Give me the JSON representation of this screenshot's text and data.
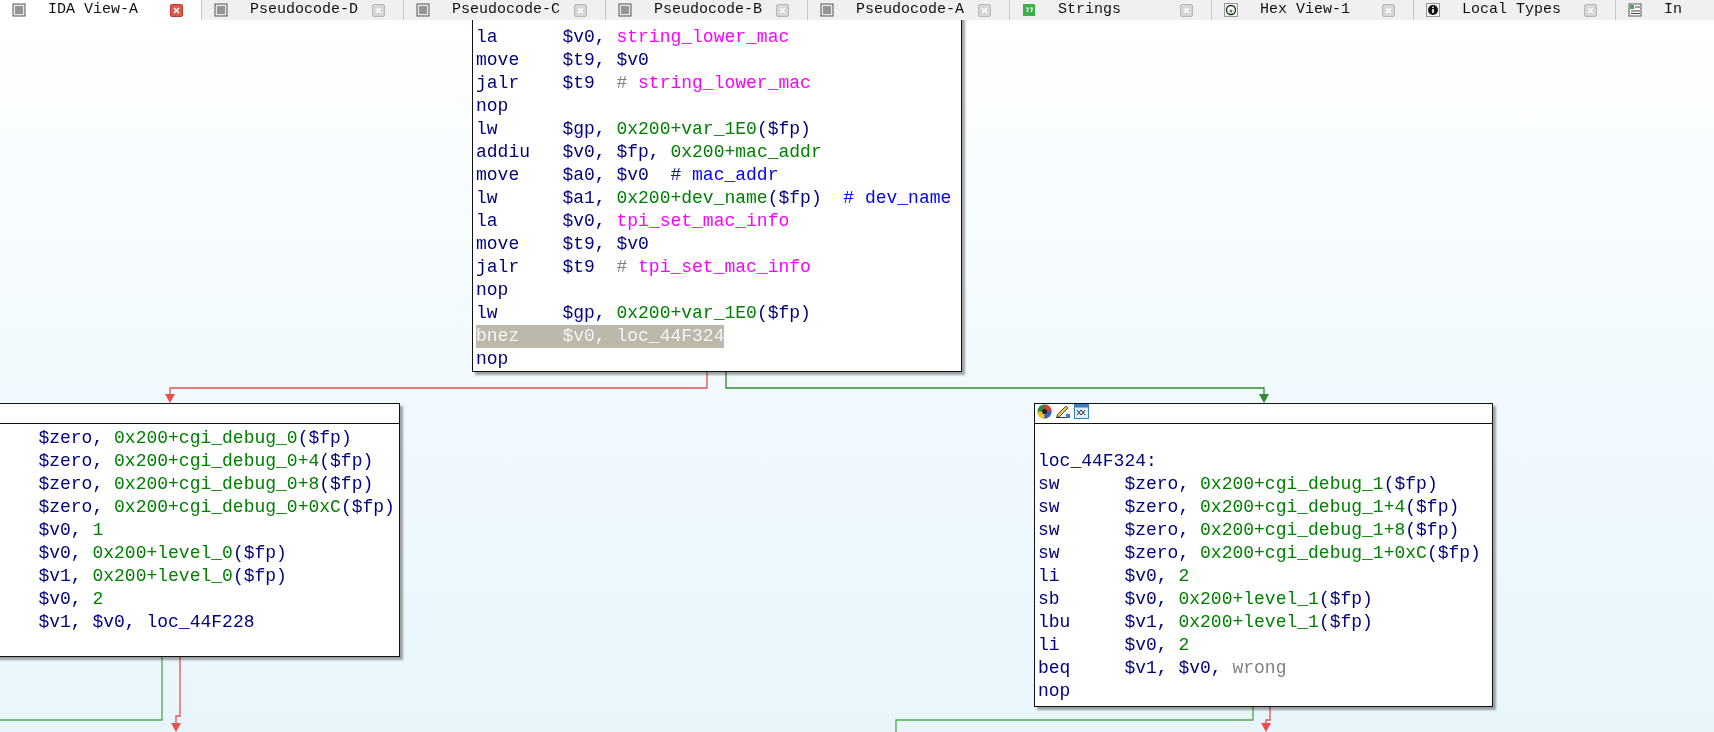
{
  "tabs": [
    {
      "label": "IDA View-A",
      "kind": "listing",
      "selected": true,
      "closable": true
    },
    {
      "label": "Pseudocode-D",
      "kind": "listing",
      "selected": false,
      "closable": true
    },
    {
      "label": "Pseudocode-C",
      "kind": "listing",
      "selected": false,
      "closable": true
    },
    {
      "label": "Pseudocode-B",
      "kind": "listing",
      "selected": false,
      "closable": true
    },
    {
      "label": "Pseudocode-A",
      "kind": "listing",
      "selected": false,
      "closable": true
    },
    {
      "label": "Strings",
      "kind": "strings",
      "selected": false,
      "closable": true
    },
    {
      "label": "Hex View-1",
      "kind": "hex",
      "selected": false,
      "closable": true
    },
    {
      "label": "Local Types",
      "kind": "types",
      "selected": false,
      "closable": true
    },
    {
      "label": "In",
      "kind": "structures",
      "selected": false
    }
  ],
  "graph": {
    "blocks": [
      {
        "kind": "top",
        "lines": [
          {
            "kind": "insn",
            "selected": false,
            "mnemonic": "la",
            "operands": [
              [
                {
                  "text": "$v0,",
                  "kind": "reg"
                }
              ],
              [
                {
                  "text": "string_lower_mac",
                  "kind": "name"
                }
              ]
            ]
          },
          {
            "kind": "insn",
            "selected": false,
            "mnemonic": "move",
            "operands": [
              [
                {
                  "text": "$t9,",
                  "kind": "reg"
                }
              ],
              [
                {
                  "text": "$v0",
                  "kind": "reg"
                }
              ]
            ]
          },
          {
            "kind": "insn",
            "selected": false,
            "mnemonic": "jalr",
            "operands": [
              [
                {
                  "text": "$t9",
                  "kind": "reg"
                }
              ]
            ],
            "comment": [
              [
                {
                  "text": "#",
                  "kind": "mark"
                }
              ],
              [
                {
                  "text": "string_lower_mac",
                  "kind": "name"
                }
              ]
            ]
          },
          {
            "kind": "insn",
            "selected": false,
            "mnemonic": "nop"
          },
          {
            "kind": "insn",
            "selected": false,
            "mnemonic": "lw",
            "operands": [
              [
                {
                  "text": "$gp,",
                  "kind": "reg"
                }
              ],
              [
                {
                  "text": "0x200+var_1E0",
                  "kind": "num"
                },
                {
                  "text": "($fp)",
                  "kind": "reg"
                }
              ]
            ]
          },
          {
            "kind": "insn",
            "selected": false,
            "mnemonic": "addiu",
            "operands": [
              [
                {
                  "text": "$v0,",
                  "kind": "reg"
                }
              ],
              [
                {
                  "text": "$fp,",
                  "kind": "reg"
                }
              ],
              [
                {
                  "text": "0x200+mac_addr",
                  "kind": "num"
                }
              ]
            ]
          },
          {
            "kind": "insn",
            "selected": false,
            "mnemonic": "move",
            "operands": [
              [
                {
                  "text": "$a0,",
                  "kind": "reg"
                }
              ],
              [
                {
                  "text": "$v0",
                  "kind": "reg"
                }
              ]
            ],
            "comment": [
              [
                {
                  "text": "#",
                  "kind": "cname"
                }
              ],
              [
                {
                  "text": "mac_addr",
                  "kind": "cname"
                }
              ]
            ]
          },
          {
            "kind": "insn",
            "selected": false,
            "mnemonic": "lw",
            "operands": [
              [
                {
                  "text": "$a1,",
                  "kind": "reg"
                }
              ],
              [
                {
                  "text": "0x200+dev_name",
                  "kind": "num"
                },
                {
                  "text": "($fp)",
                  "kind": "reg"
                }
              ]
            ],
            "comment": [
              [
                {
                  "text": "#",
                  "kind": "cname"
                }
              ],
              [
                {
                  "text": "dev_name",
                  "kind": "cname"
                }
              ]
            ]
          },
          {
            "kind": "insn",
            "selected": false,
            "mnemonic": "la",
            "operands": [
              [
                {
                  "text": "$v0,",
                  "kind": "reg"
                }
              ],
              [
                {
                  "text": "tpi_set_mac_info",
                  "kind": "name"
                }
              ]
            ]
          },
          {
            "kind": "insn",
            "selected": false,
            "mnemonic": "move",
            "operands": [
              [
                {
                  "text": "$t9,",
                  "kind": "reg"
                }
              ],
              [
                {
                  "text": "$v0",
                  "kind": "reg"
                }
              ]
            ]
          },
          {
            "kind": "insn",
            "selected": false,
            "mnemonic": "jalr",
            "operands": [
              [
                {
                  "text": "$t9",
                  "kind": "reg"
                }
              ]
            ],
            "comment": [
              [
                {
                  "text": "#",
                  "kind": "mark"
                }
              ],
              [
                {
                  "text": "tpi_set_mac_info",
                  "kind": "name"
                }
              ]
            ]
          },
          {
            "kind": "insn",
            "selected": false,
            "mnemonic": "nop"
          },
          {
            "kind": "insn",
            "selected": false,
            "mnemonic": "lw",
            "operands": [
              [
                {
                  "text": "$gp,",
                  "kind": "reg"
                }
              ],
              [
                {
                  "text": "0x200+var_1E0",
                  "kind": "num"
                },
                {
                  "text": "($fp)",
                  "kind": "reg"
                }
              ]
            ]
          },
          {
            "kind": "insn",
            "selected": true,
            "mnemonic": "bnez",
            "operands": [
              [
                {
                  "text": "$v0,",
                  "kind": "reg"
                }
              ],
              [
                {
                  "text": "loc_44F324",
                  "kind": "loc"
                }
              ]
            ]
          },
          {
            "kind": "insn",
            "selected": false,
            "mnemonic": "nop"
          }
        ]
      },
      {
        "kind": "left",
        "header_icons": false,
        "lines": [
          {
            "kind": "insn",
            "selected": false,
            "operands": [
              [
                {
                  "text": "$zero,",
                  "kind": "reg"
                }
              ],
              [
                {
                  "text": "0x200+cgi_debug_0",
                  "kind": "num"
                },
                {
                  "text": "($fp)",
                  "kind": "reg"
                }
              ]
            ]
          },
          {
            "kind": "insn",
            "selected": false,
            "operands": [
              [
                {
                  "text": "$zero,",
                  "kind": "reg"
                }
              ],
              [
                {
                  "text": "0x200+cgi_debug_0+4",
                  "kind": "num"
                },
                {
                  "text": "($fp)",
                  "kind": "reg"
                }
              ]
            ]
          },
          {
            "kind": "insn",
            "selected": false,
            "operands": [
              [
                {
                  "text": "$zero,",
                  "kind": "reg"
                }
              ],
              [
                {
                  "text": "0x200+cgi_debug_0+8",
                  "kind": "num"
                },
                {
                  "text": "($fp)",
                  "kind": "reg"
                }
              ]
            ]
          },
          {
            "kind": "insn",
            "selected": false,
            "operands": [
              [
                {
                  "text": "$zero,",
                  "kind": "reg"
                }
              ],
              [
                {
                  "text": "0x200+cgi_debug_0+0xC",
                  "kind": "num"
                },
                {
                  "text": "($fp)",
                  "kind": "reg"
                }
              ]
            ]
          },
          {
            "kind": "insn",
            "selected": false,
            "operands": [
              [
                {
                  "text": "$v0,",
                  "kind": "reg"
                }
              ],
              [
                {
                  "text": "1",
                  "kind": "num"
                }
              ]
            ]
          },
          {
            "kind": "insn",
            "selected": false,
            "operands": [
              [
                {
                  "text": "$v0,",
                  "kind": "reg"
                }
              ],
              [
                {
                  "text": "0x200+level_0",
                  "kind": "num"
                },
                {
                  "text": "($fp)",
                  "kind": "reg"
                }
              ]
            ]
          },
          {
            "kind": "insn",
            "selected": false,
            "operands": [
              [
                {
                  "text": "$v1,",
                  "kind": "reg"
                }
              ],
              [
                {
                  "text": "0x200+level_0",
                  "kind": "num"
                },
                {
                  "text": "($fp)",
                  "kind": "reg"
                }
              ]
            ]
          },
          {
            "kind": "insn",
            "selected": false,
            "operands": [
              [
                {
                  "text": "$v0,",
                  "kind": "reg"
                }
              ],
              [
                {
                  "text": "2",
                  "kind": "num"
                }
              ]
            ]
          },
          {
            "kind": "insn",
            "selected": false,
            "operands": [
              [
                {
                  "text": "$v1,",
                  "kind": "reg"
                }
              ],
              [
                {
                  "text": "$v0,",
                  "kind": "reg"
                }
              ],
              [
                {
                  "text": "loc_44F228",
                  "kind": "loc"
                }
              ]
            ]
          }
        ]
      },
      {
        "kind": "right",
        "header_icons": true,
        "lines": [
          {
            "kind": "label",
            "selected": false,
            "text": "loc_44F324:"
          },
          {
            "kind": "insn",
            "selected": false,
            "mnemonic": "sw",
            "operands": [
              [
                {
                  "text": "$zero,",
                  "kind": "reg"
                }
              ],
              [
                {
                  "text": "0x200+cgi_debug_1",
                  "kind": "num"
                },
                {
                  "text": "($fp)",
                  "kind": "reg"
                }
              ]
            ]
          },
          {
            "kind": "insn",
            "selected": false,
            "mnemonic": "sw",
            "operands": [
              [
                {
                  "text": "$zero,",
                  "kind": "reg"
                }
              ],
              [
                {
                  "text": "0x200+cgi_debug_1+4",
                  "kind": "num"
                },
                {
                  "text": "($fp)",
                  "kind": "reg"
                }
              ]
            ]
          },
          {
            "kind": "insn",
            "selected": false,
            "mnemonic": "sw",
            "operands": [
              [
                {
                  "text": "$zero,",
                  "kind": "reg"
                }
              ],
              [
                {
                  "text": "0x200+cgi_debug_1+8",
                  "kind": "num"
                },
                {
                  "text": "($fp)",
                  "kind": "reg"
                }
              ]
            ]
          },
          {
            "kind": "insn",
            "selected": false,
            "mnemonic": "sw",
            "operands": [
              [
                {
                  "text": "$zero,",
                  "kind": "reg"
                }
              ],
              [
                {
                  "text": "0x200+cgi_debug_1+0xC",
                  "kind": "num"
                },
                {
                  "text": "($fp)",
                  "kind": "reg"
                }
              ]
            ]
          },
          {
            "kind": "insn",
            "selected": false,
            "mnemonic": "li",
            "operands": [
              [
                {
                  "text": "$v0,",
                  "kind": "reg"
                }
              ],
              [
                {
                  "text": "2",
                  "kind": "num"
                }
              ]
            ]
          },
          {
            "kind": "insn",
            "selected": false,
            "mnemonic": "sb",
            "operands": [
              [
                {
                  "text": "$v0,",
                  "kind": "reg"
                }
              ],
              [
                {
                  "text": "0x200+level_1",
                  "kind": "num"
                },
                {
                  "text": "($fp)",
                  "kind": "reg"
                }
              ]
            ]
          },
          {
            "kind": "insn",
            "selected": false,
            "mnemonic": "lbu",
            "operands": [
              [
                {
                  "text": "$v1,",
                  "kind": "reg"
                }
              ],
              [
                {
                  "text": "0x200+level_1",
                  "kind": "num"
                },
                {
                  "text": "($fp)",
                  "kind": "reg"
                }
              ]
            ]
          },
          {
            "kind": "insn",
            "selected": false,
            "mnemonic": "li",
            "operands": [
              [
                {
                  "text": "$v0,",
                  "kind": "reg"
                }
              ],
              [
                {
                  "text": "2",
                  "kind": "num"
                }
              ]
            ]
          },
          {
            "kind": "insn",
            "selected": false,
            "mnemonic": "beq",
            "operands": [
              [
                {
                  "text": "$v1,",
                  "kind": "reg"
                }
              ],
              [
                {
                  "text": "$v0,",
                  "kind": "reg"
                }
              ],
              [
                {
                  "text": "wrong",
                  "kind": "ref"
                }
              ]
            ]
          },
          {
            "kind": "insn",
            "selected": false,
            "mnemonic": "nop"
          }
        ]
      }
    ]
  }
}
